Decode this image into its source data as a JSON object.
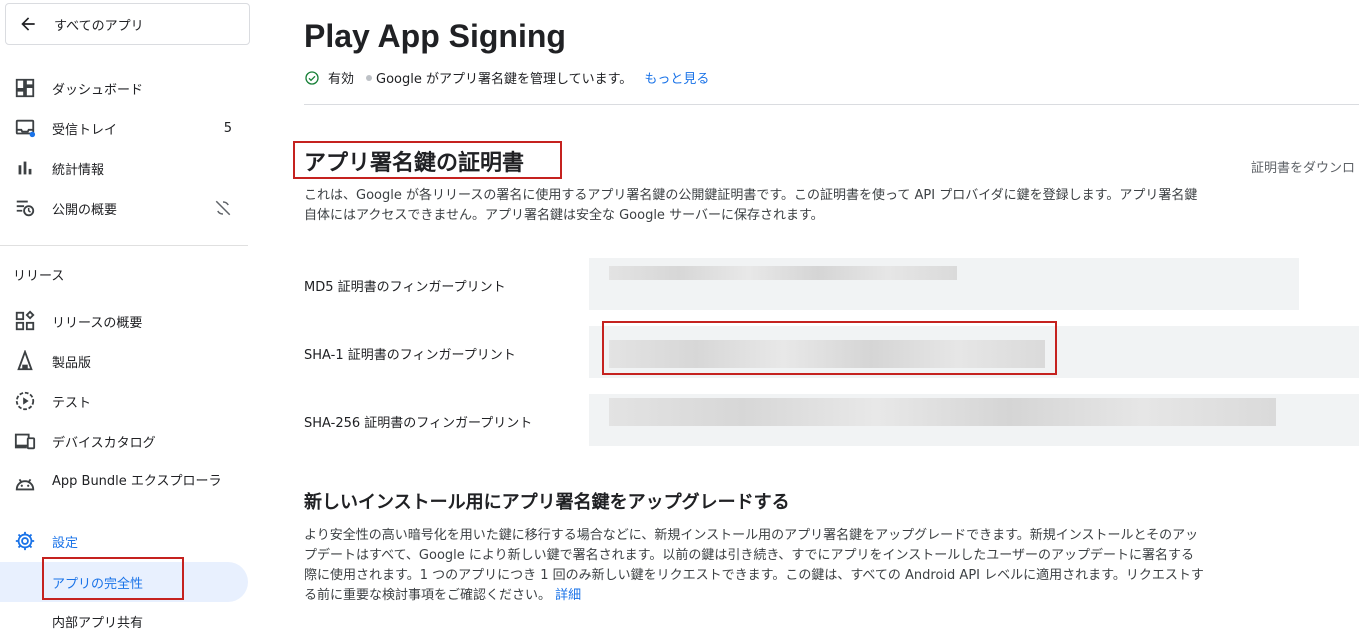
{
  "sidebar": {
    "back_label": "すべてのアプリ",
    "items": [
      {
        "label": "ダッシュボード",
        "icon": "dashboard-icon"
      },
      {
        "label": "受信トレイ",
        "icon": "inbox-icon",
        "badge": "5"
      },
      {
        "label": "統計情報",
        "icon": "bar-chart-icon"
      },
      {
        "label": "公開の概要",
        "icon": "publishing-overview-icon"
      }
    ],
    "release_section": "リリース",
    "release_items": [
      {
        "label": "リリースの概要",
        "icon": "release-overview-icon"
      },
      {
        "label": "製品版",
        "icon": "production-icon"
      },
      {
        "label": "テスト",
        "icon": "test-icon"
      },
      {
        "label": "デバイスカタログ",
        "icon": "devices-icon"
      },
      {
        "label": "App Bundle エクスプローラ",
        "icon": "android-icon"
      }
    ],
    "settings_label": "設定",
    "settings_children": [
      {
        "label": "アプリの完全性",
        "selected": true
      },
      {
        "label": "内部アプリ共有"
      }
    ]
  },
  "main": {
    "title": "Play App Signing",
    "status": {
      "state": "有効",
      "description": "Google がアプリ署名鍵を管理しています。",
      "more_link": "もっと見る"
    },
    "cert_section": {
      "title": "アプリ署名鍵の証明書",
      "download": "証明書をダウンロ",
      "description": "これは、Google が各リリースの署名に使用するアプリ署名鍵の公開鍵証明書です。この証明書を使って API プロバイダに鍵を登録します。アプリ署名鍵自体にはアクセスできません。アプリ署名鍵は安全な Google サーバーに保存されます。",
      "fingerprints": [
        {
          "label": "MD5 証明書のフィンガープリント"
        },
        {
          "label": "SHA-1 証明書のフィンガープリント"
        },
        {
          "label": "SHA-256 証明書のフィンガープリント"
        }
      ]
    },
    "upgrade_section": {
      "title": "新しいインストール用にアプリ署名鍵をアップグレードする",
      "description": "より安全性の高い暗号化を用いた鍵に移行する場合などに、新規インストール用のアプリ署名鍵をアップグレードできます。新規インストールとそのアップデートはすべて、Google により新しい鍵で署名されます。以前の鍵は引き続き、すでにアプリをインストールしたユーザーのアップデートに署名する際に使用されます。1 つのアプリにつき 1 回のみ新しい鍵をリクエストできます。この鍵は、すべての Android API レベルに適用されます。リクエストする前に重要な検討事項をご確認ください。",
      "details_link": "詳細"
    }
  },
  "colors": {
    "accent": "#1a73e8",
    "highlight_box": "#c5221f",
    "selected_bg": "#e8f0fe"
  }
}
